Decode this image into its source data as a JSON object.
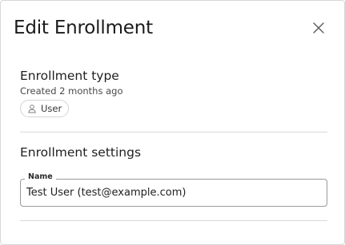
{
  "dialog": {
    "title": "Edit Enrollment",
    "close_icon": "close-icon"
  },
  "enrollment_type": {
    "heading": "Enrollment type",
    "created": "Created 2 months ago",
    "chip": {
      "icon": "user-icon",
      "label": "User"
    }
  },
  "enrollment_settings": {
    "heading": "Enrollment settings",
    "name_field": {
      "label": "Name",
      "value": "Test User (test@example.com)"
    }
  },
  "colors": {
    "border": "#d8d8d8",
    "divider": "#d9d9d9",
    "field_border": "#9a9a9a",
    "text": "#1f1f1f"
  }
}
